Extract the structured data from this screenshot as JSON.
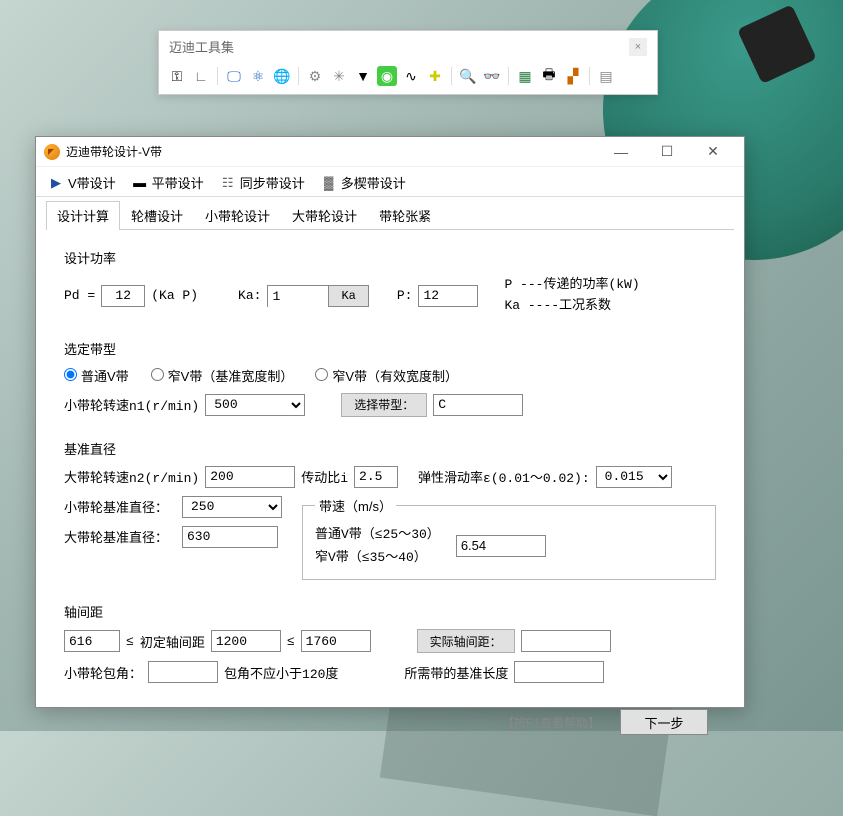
{
  "toolbar": {
    "title": "迈迪工具集"
  },
  "dialog": {
    "title": "迈迪带轮设计-V带",
    "main_tabs": [
      {
        "label": "V带设计",
        "icon": "▶"
      },
      {
        "label": "平带设计",
        "icon": "▬"
      },
      {
        "label": "同步带设计",
        "icon": "☷"
      },
      {
        "label": "多楔带设计",
        "icon": "▓"
      }
    ],
    "sub_tabs": [
      "设计计算",
      "轮槽设计",
      "小带轮设计",
      "大带轮设计",
      "带轮张紧"
    ]
  },
  "design_power": {
    "title": "设计功率",
    "formula_prefix": "Pd =",
    "formula_value": "12",
    "formula_suffix": "(Ka P)",
    "ka_label": "Ka:",
    "ka_value": "1",
    "ka_button": "Ka",
    "p_label": "P:",
    "p_value": "12",
    "note1": "P ---传递的功率(kW)",
    "note2": "Ka ----工况系数"
  },
  "belt_type": {
    "title": "选定带型",
    "options": [
      "普通V带",
      "窄V带（基准宽度制）",
      "窄V带（有效宽度制）"
    ],
    "speed_label": "小带轮转速n1(r/min)",
    "speed_value": "500",
    "select_label": "选择带型：",
    "selected_type": "C"
  },
  "base_diameter": {
    "title": "基准直径",
    "big_speed_label": "大带轮转速n2(r/min)",
    "big_speed_value": "200",
    "ratio_label": "传动比i",
    "ratio_value": "2.5",
    "slip_label": "弹性滑动率ε(0.01～0.02):",
    "slip_value": "0.015",
    "small_dia_label": "小带轮基准直径：",
    "small_dia_value": "250",
    "big_dia_label": "大带轮基准直径：",
    "big_dia_value": "630",
    "speed_group_title": "带速（m/s）",
    "speed_note1": "普通V带（≤25～30）",
    "speed_note2": "窄V带（≤35～40）",
    "speed_result": "6.54"
  },
  "axis_distance": {
    "title": "轴间距",
    "min_value": "616",
    "le1": "≤",
    "init_label": "初定轴间距",
    "init_value": "1200",
    "le2": "≤",
    "max_value": "1760",
    "actual_label": "实际轴间距：",
    "actual_value": "",
    "wrap_label": "小带轮包角：",
    "wrap_value": "",
    "wrap_note": "包角不应小于120度",
    "length_label": "所需带的基准长度",
    "length_value": ""
  },
  "footer": {
    "help": "【按F1查看帮助】",
    "next": "下一步"
  }
}
